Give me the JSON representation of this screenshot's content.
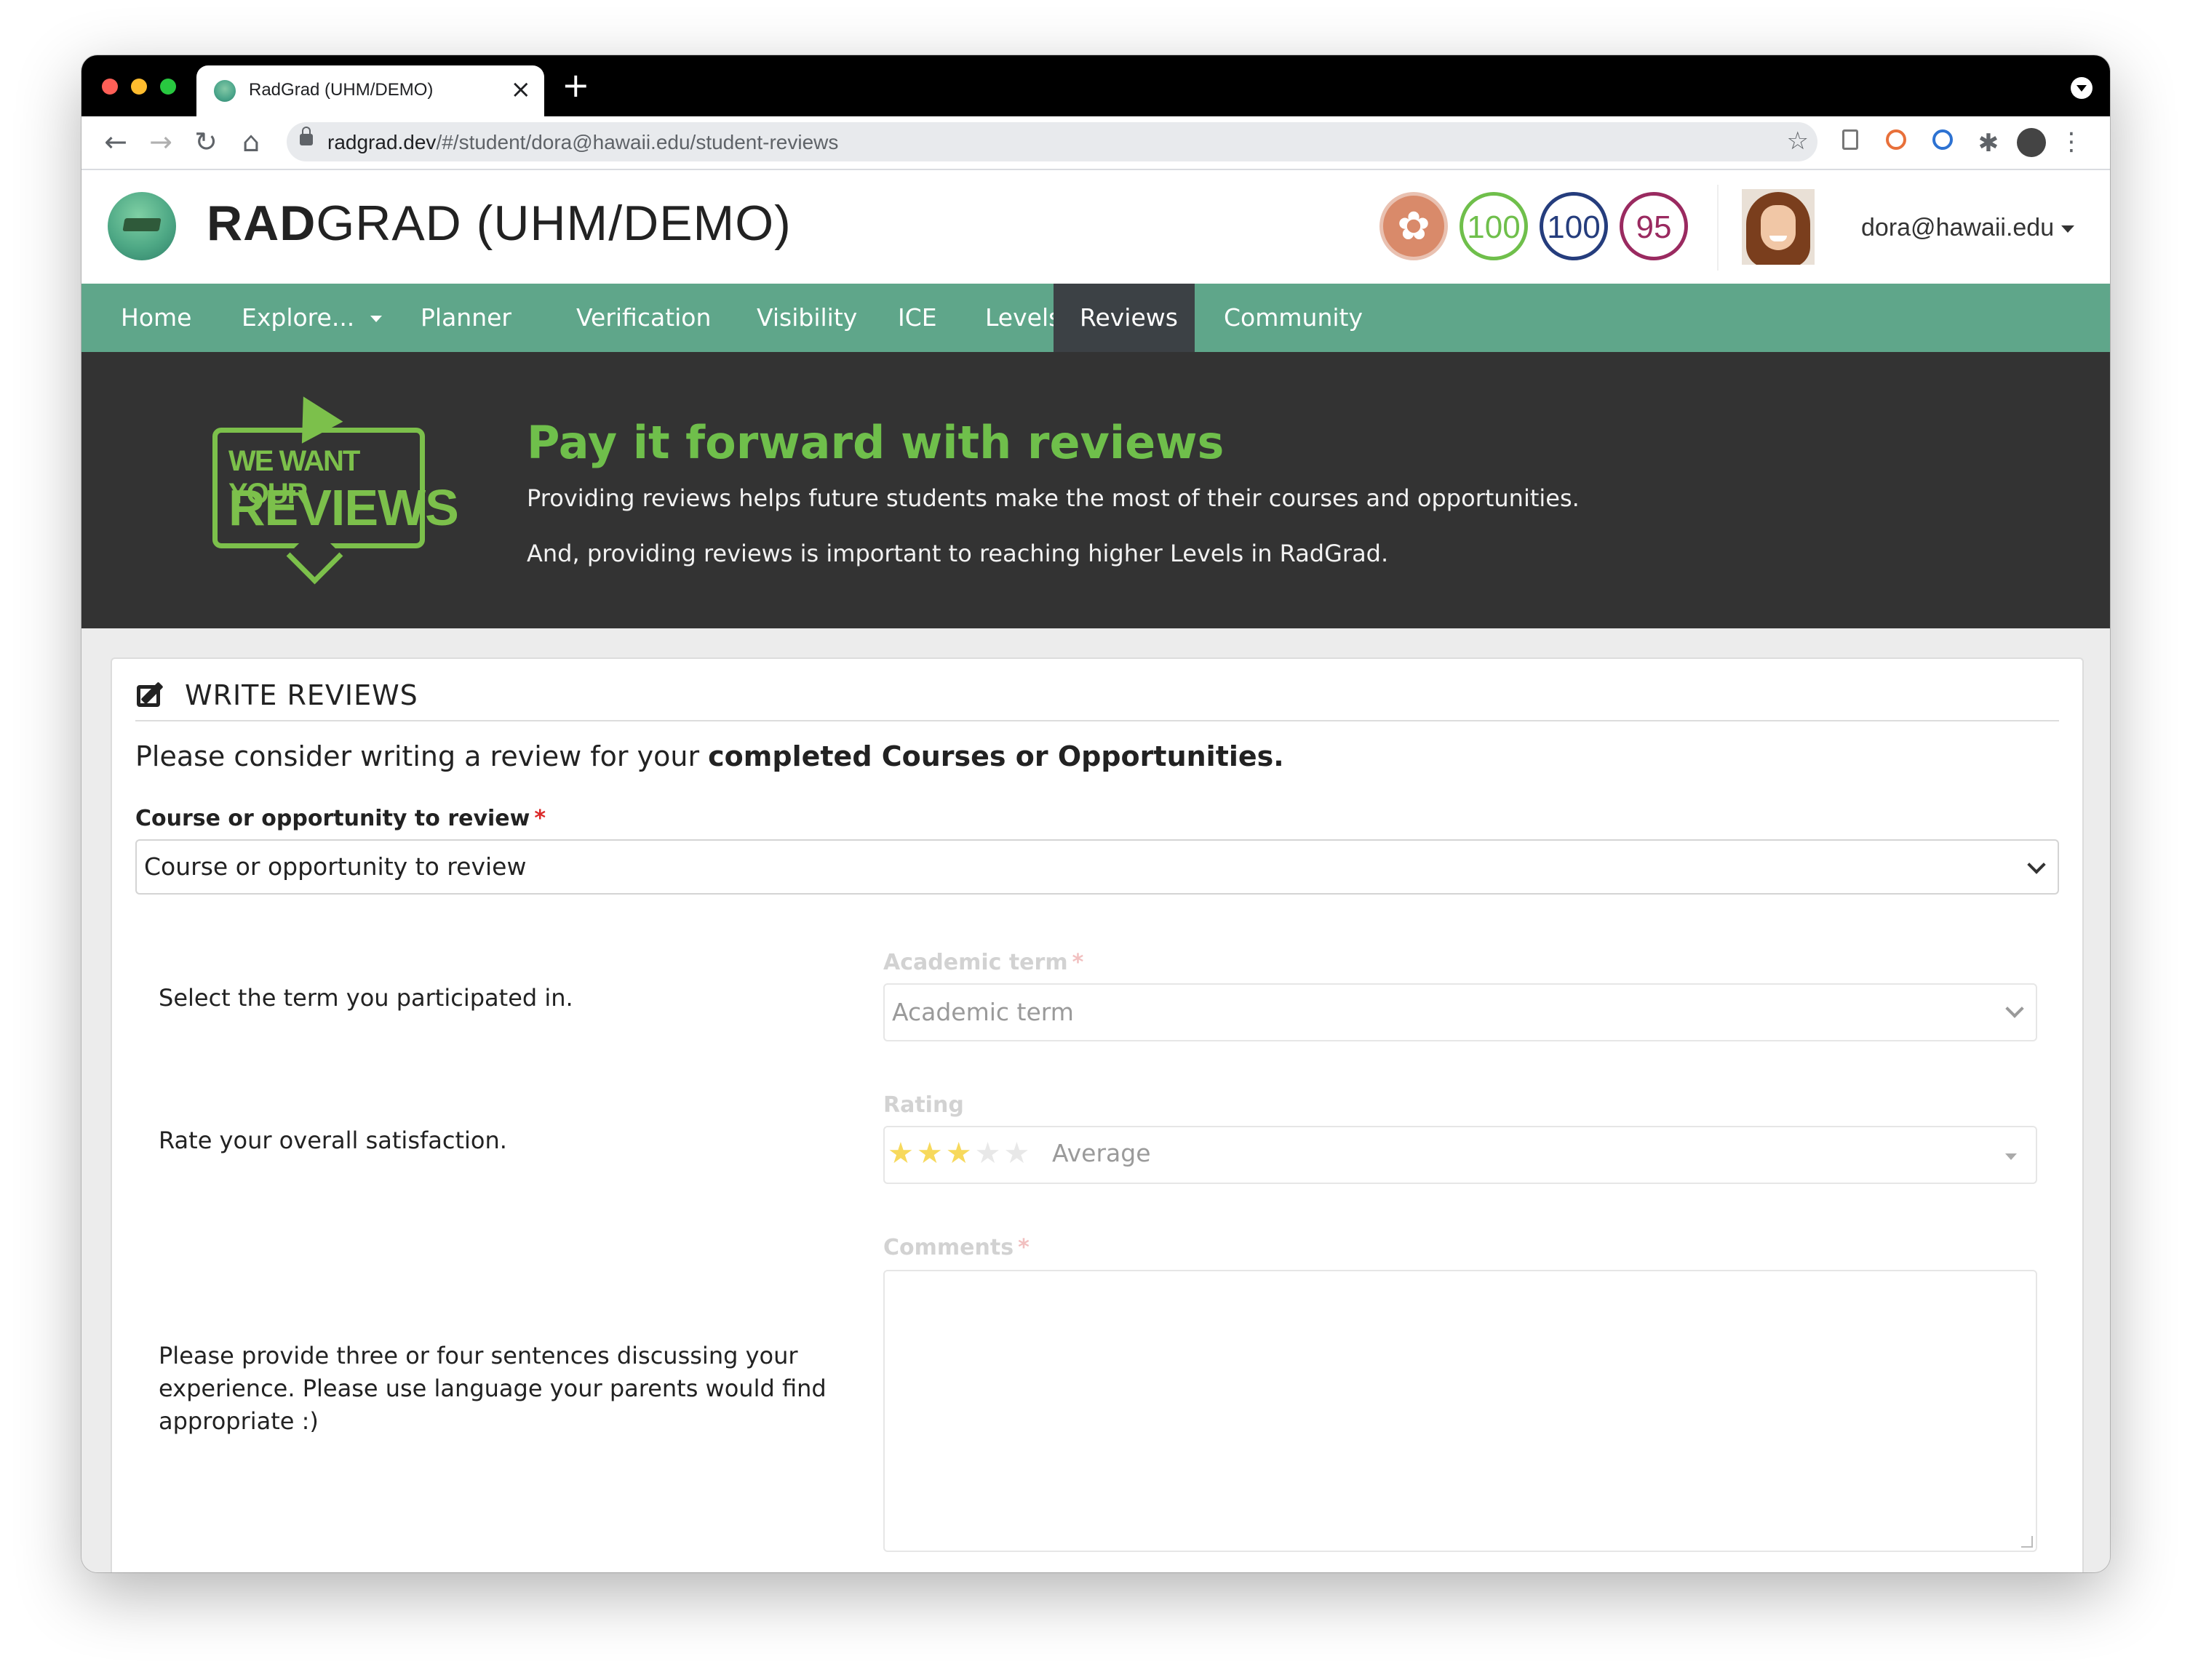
{
  "browser": {
    "tab_title": "RadGrad (UHM/DEMO)",
    "url_domain": "radgrad.dev",
    "url_path": "/#/student/dora@hawaii.edu/student-reviews"
  },
  "header": {
    "brand_bold": "RAD",
    "brand_rest": "GRAD (UHM/DEMO)",
    "badges": {
      "innovation": "100",
      "competency": "100",
      "experience": "95"
    },
    "user": "dora@hawaii.edu"
  },
  "nav": {
    "items": [
      {
        "label": "Home"
      },
      {
        "label": "Explore..."
      },
      {
        "label": "Planner"
      },
      {
        "label": "Verification"
      },
      {
        "label": "Visibility"
      },
      {
        "label": "ICE"
      },
      {
        "label": "Levels"
      },
      {
        "label": "Reviews",
        "active": true
      },
      {
        "label": "Community"
      }
    ]
  },
  "banner": {
    "promo_line1": "WE WANT YOUR",
    "promo_line2": "REVIEWS",
    "title": "Pay it forward with reviews",
    "text1": "Providing reviews helps future students make the most of their courses and opportunities.",
    "text2": "And, providing reviews is important to reaching higher Levels in RadGrad."
  },
  "form": {
    "title": "WRITE REVIEWS",
    "intro_plain": "Please consider writing a review for your ",
    "intro_bold": "completed Courses or Opportunities.",
    "course_label": "Course or opportunity to review",
    "course_value": "Course or opportunity to review",
    "term_help": "Select the term you participated in.",
    "term_label": "Academic term",
    "term_value": "Academic term",
    "rating_help": "Rate your overall satisfaction.",
    "rating_label": "Rating",
    "rating_value": 3,
    "rating_max": 5,
    "rating_text": "Average",
    "comments_label": "Comments",
    "comments_help": "Please provide three or four sentences discussing your experience. Please use language your parents would find appropriate :)",
    "comments_value": "",
    "required_mark": "*"
  }
}
